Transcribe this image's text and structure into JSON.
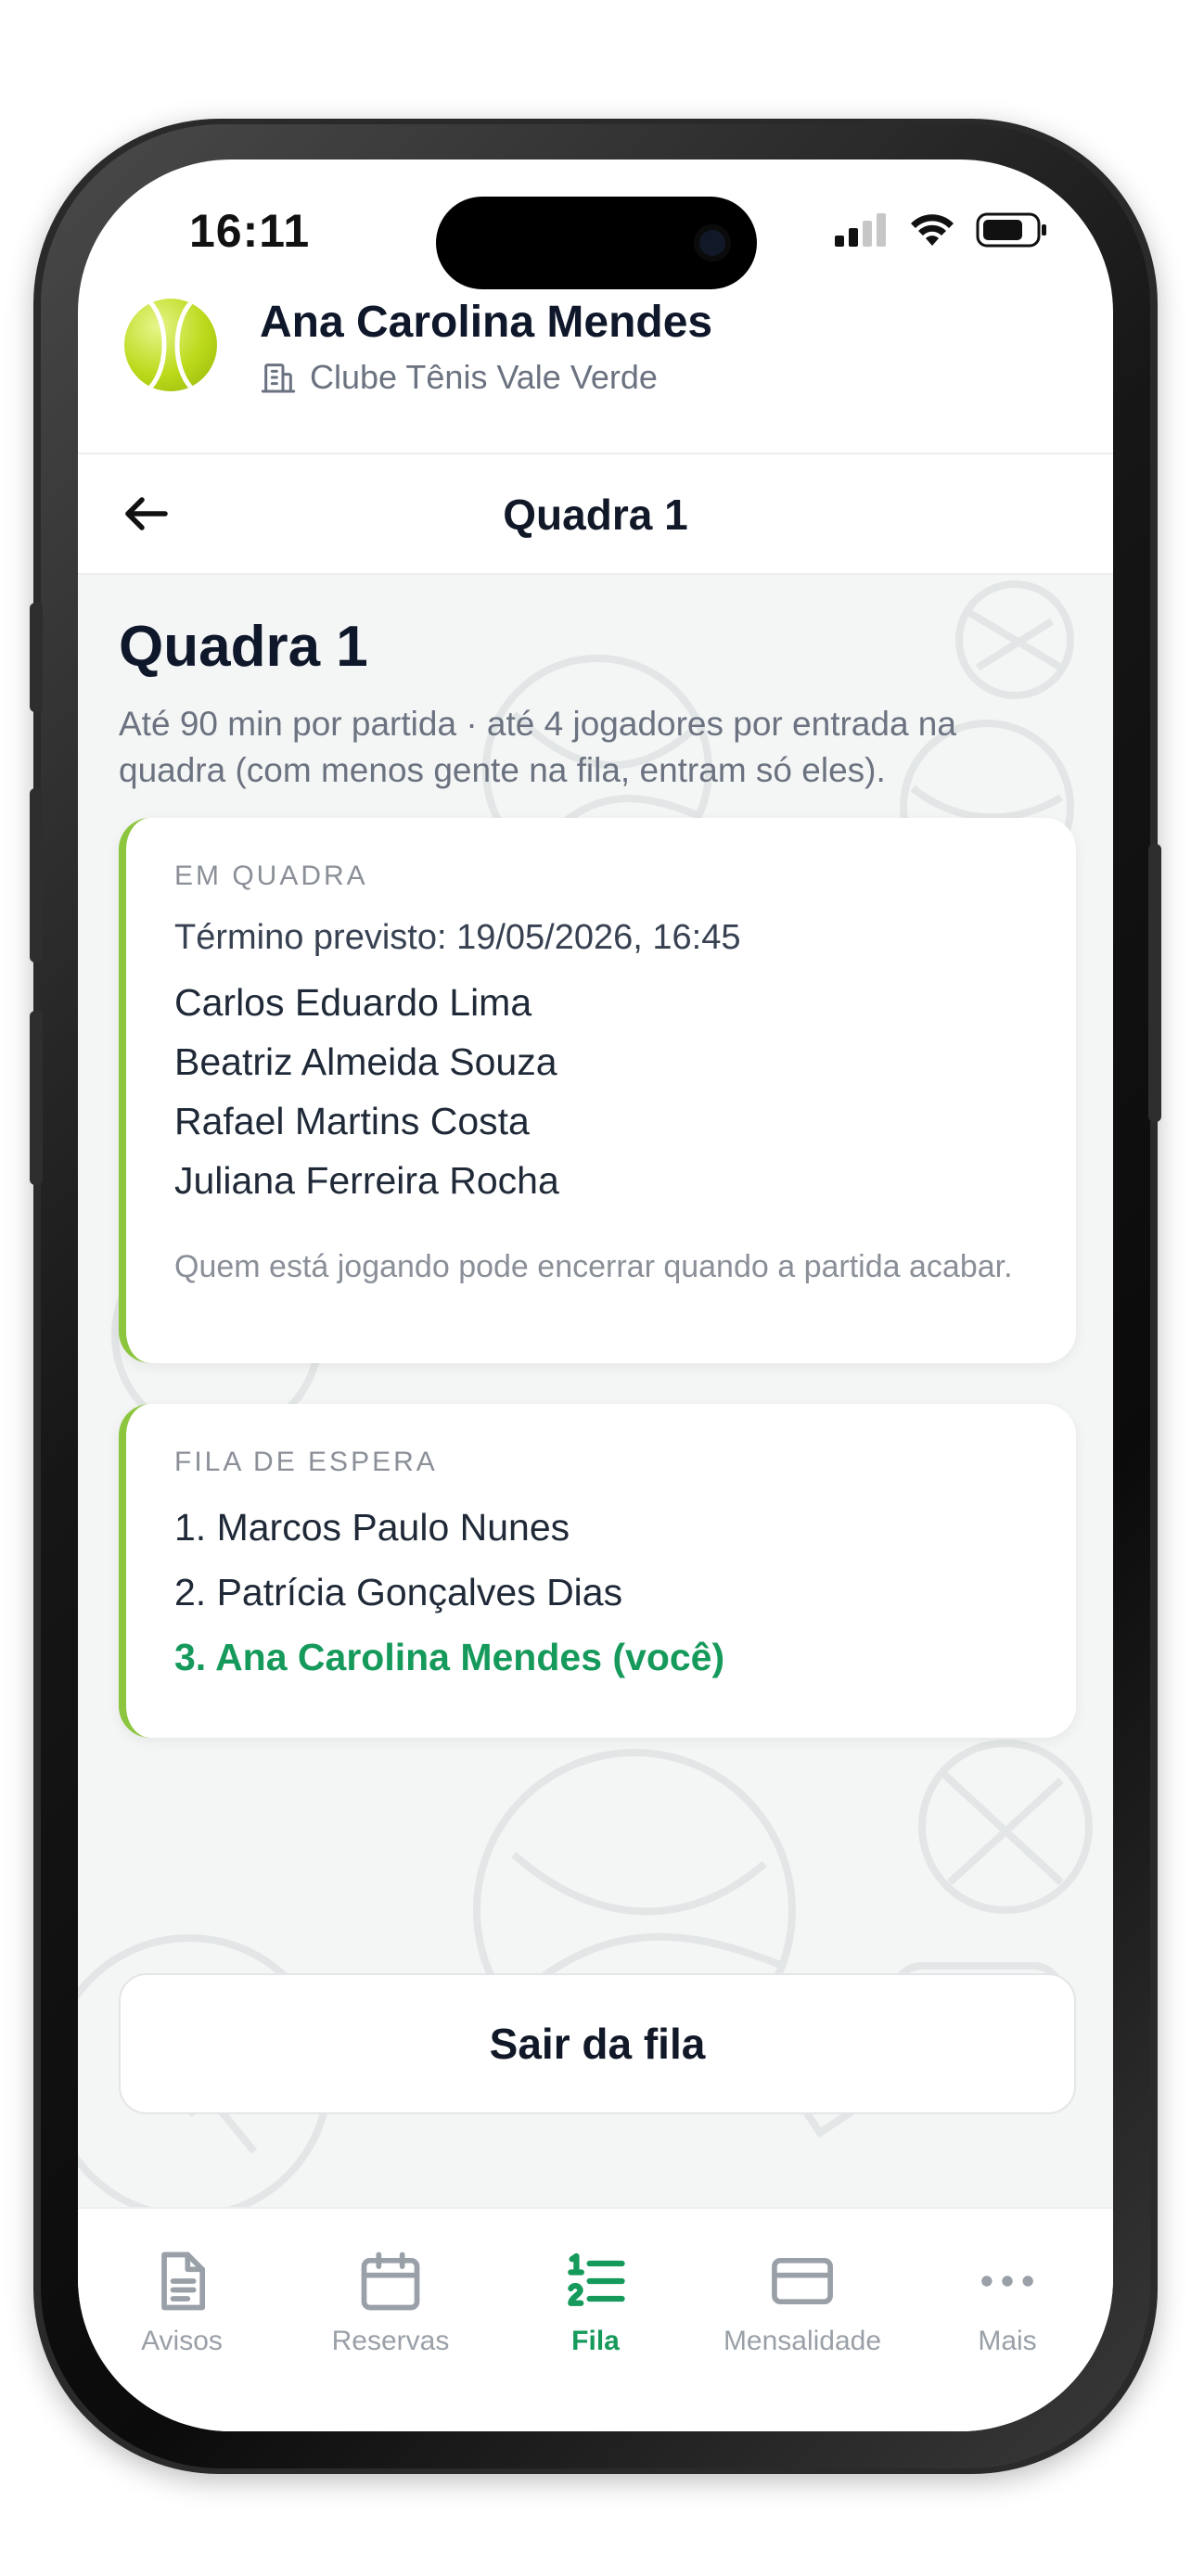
{
  "status_bar": {
    "time": "16:11"
  },
  "profile": {
    "name": "Ana Carolina Mendes",
    "club": "Clube Tênis Vale Verde"
  },
  "navbar": {
    "title": "Quadra 1"
  },
  "page": {
    "title": "Quadra 1",
    "description": "Até 90 min por partida · até 4 jogadores por entrada na quadra (com menos gente na fila, entram só eles)."
  },
  "on_court": {
    "label": "EM QUADRA",
    "end_time": "Término previsto: 19/05/2026, 16:45",
    "players": [
      "Carlos Eduardo Lima",
      "Beatriz Almeida Souza",
      "Rafael Martins Costa",
      "Juliana Ferreira Rocha"
    ],
    "note": "Quem está jogando pode encerrar quando a partida acabar."
  },
  "queue": {
    "label": "FILA DE ESPERA",
    "items": [
      "1. Marcos Paulo Nunes",
      "2. Patrícia Gonçalves Dias",
      "3. Ana Carolina Mendes (você)"
    ]
  },
  "actions": {
    "leave_queue": "Sair da fila"
  },
  "tabs": [
    {
      "label": "Avisos",
      "icon": "document-icon",
      "active": false
    },
    {
      "label": "Reservas",
      "icon": "calendar-icon",
      "active": false
    },
    {
      "label": "Fila",
      "icon": "numbered-list-icon",
      "active": true
    },
    {
      "label": "Mensalidade",
      "icon": "card-icon",
      "active": false
    },
    {
      "label": "Mais",
      "icon": "more-icon",
      "active": false
    }
  ],
  "colors": {
    "accent": "#169a5b",
    "card_border": "#8cc63f",
    "muted": "#6b7280"
  }
}
